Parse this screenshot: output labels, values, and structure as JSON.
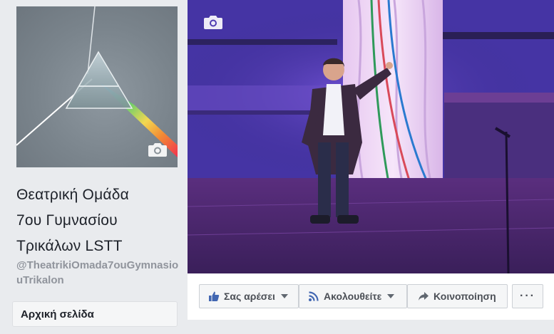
{
  "page": {
    "name": "Θεατρική Ομάδα 7ου Γυμνασίου Τρικάλων LSTT",
    "name_lines": [
      "Θεατρική Ομάδα",
      "7ου Γυμνασίου",
      "Τρικάλων LSTT"
    ],
    "handle": "@TheatrikiOmada7ouGymnasiouTrikalon"
  },
  "nav": {
    "home_label": "Αρχική σελίδα"
  },
  "actions": {
    "like_label": "Σας αρέσει",
    "follow_label": "Ακολουθείτε",
    "share_label": "Κοινοποίηση",
    "more_label": "···"
  },
  "icons": {
    "profile_camera": "camera-icon",
    "cover_camera": "camera-icon",
    "like": "thumbs-up-icon",
    "follow": "rss-icon",
    "share": "share-arrow-icon"
  },
  "colors": {
    "background": "#e9ebee",
    "fb_blue": "#4267b2",
    "text_primary": "#1d2129",
    "text_secondary": "#90949c"
  }
}
